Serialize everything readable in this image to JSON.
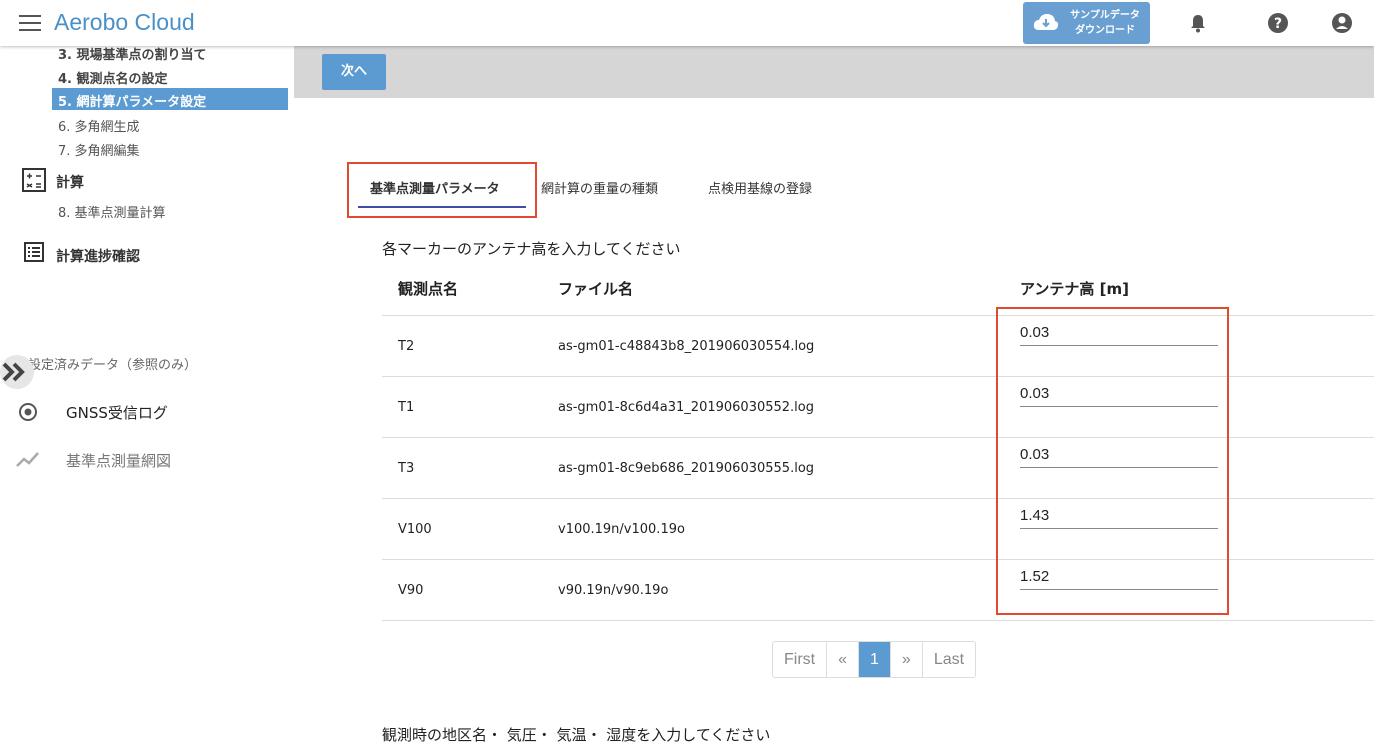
{
  "header": {
    "title": "Aerobo Cloud",
    "download_label_1": "サンプルデータ",
    "download_label_2": "ダウンロード"
  },
  "sidebar": {
    "steps": [
      {
        "label": "3. 現場基準点の割り当て"
      },
      {
        "label": "4. 観測点名の設定"
      },
      {
        "label": "5. 網計算パラメータ設定"
      },
      {
        "label": "6. 多角網生成"
      },
      {
        "label": "7. 多角網編集"
      }
    ],
    "calc_section": "計算",
    "calc_step": "8. 基準点測量計算",
    "progress_section": "計算進捗確認",
    "ref_label": "設定済みデータ（参照のみ）",
    "nav": [
      {
        "label": "GNSS受信ログ"
      },
      {
        "label": "基準点測量網図"
      }
    ]
  },
  "toolbar": {
    "next_label": "次へ"
  },
  "tabs": [
    {
      "label": "基準点測量パラメータ"
    },
    {
      "label": "網計算の重量の種類"
    },
    {
      "label": "点検用基線の登録"
    }
  ],
  "main": {
    "instruction": "各マーカーのアンテナ高を入力してください",
    "columns": [
      "観測点名",
      "ファイル名",
      "アンテナ高 [m]"
    ],
    "rows": [
      {
        "name": "T2",
        "file": "as-gm01-c48843b8_201906030554.log",
        "height": "0.03"
      },
      {
        "name": "T1",
        "file": "as-gm01-8c6d4a31_201906030552.log",
        "height": "0.03"
      },
      {
        "name": "T3",
        "file": "as-gm01-8c9eb686_201906030555.log",
        "height": "0.03"
      },
      {
        "name": "V100",
        "file": "v100.19n/v100.19o",
        "height": "1.43"
      },
      {
        "name": "V90",
        "file": "v90.19n/v90.19o",
        "height": "1.52"
      }
    ],
    "pagination": {
      "first": "First",
      "prev": "«",
      "current": "1",
      "next": "»",
      "last": "Last"
    },
    "instruction2": "観測時の地区名・ 気圧・ 気温・ 湿度を入力してください"
  },
  "colors": {
    "accent": "#5b9bd1",
    "highlight_box": "#e04b2f",
    "tab_underline": "#3f4ca8"
  }
}
